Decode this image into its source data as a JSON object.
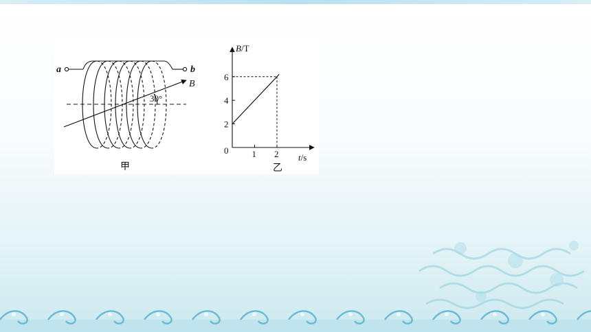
{
  "diagram_jia": {
    "terminal_a": "a",
    "terminal_b": "b",
    "field_label": "B",
    "angle_label": "30°",
    "caption": "甲"
  },
  "graph_yi": {
    "y_label_var": "B",
    "y_label_unit": "/T",
    "x_label_var": "t",
    "x_label_unit": "/s",
    "origin": "0",
    "caption": "乙"
  },
  "chart_data": {
    "type": "line",
    "x": [
      0,
      2
    ],
    "y": [
      2,
      6
    ],
    "xlabel": "t/s",
    "ylabel": "B/T",
    "x_ticks": [
      "1",
      "2"
    ],
    "y_ticks": [
      "2",
      "4",
      "6"
    ],
    "xlim": [
      0,
      3.5
    ],
    "ylim": [
      0,
      6.6
    ],
    "line_extends_to": [
      2.1,
      6.2
    ],
    "dashed_guides": [
      [
        2,
        6
      ]
    ]
  },
  "colors": {
    "ink": "#111111",
    "panel": "#ffffff",
    "wave": "#7cc8dc"
  }
}
